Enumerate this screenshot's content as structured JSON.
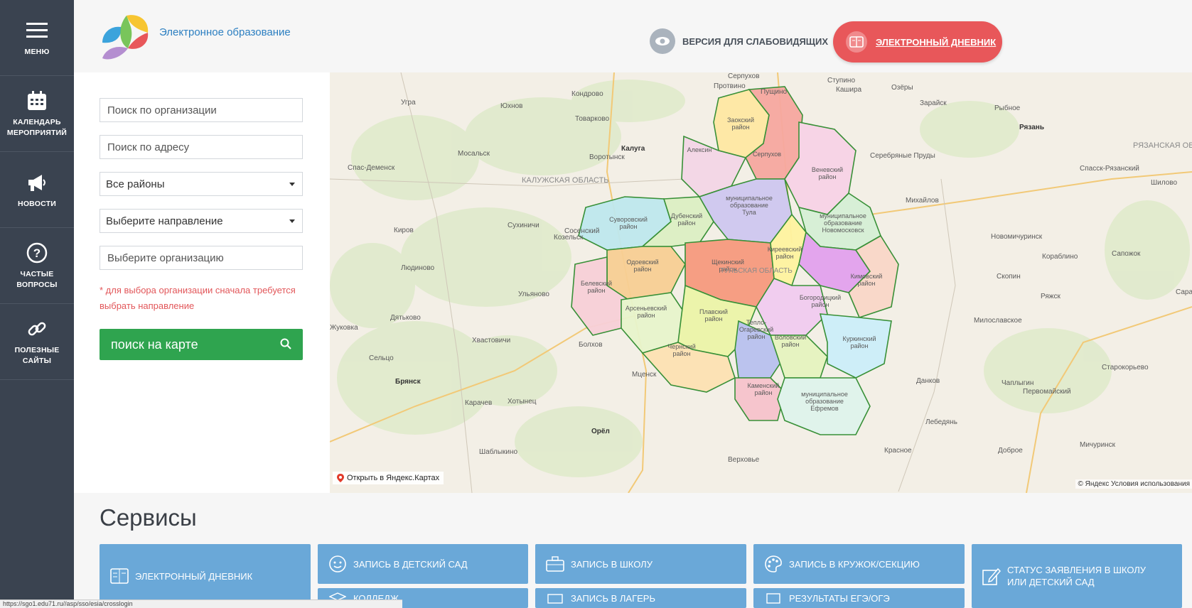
{
  "sidebar": {
    "items": [
      {
        "label": "Меню",
        "icon": "hamburger-icon"
      },
      {
        "label": "Календарь\nмероприятий",
        "icon": "calendar-icon"
      },
      {
        "label": "Новости",
        "icon": "megaphone-icon"
      },
      {
        "label": "Частые вопросы",
        "icon": "question-icon"
      },
      {
        "label": "Полезные сайты",
        "icon": "link-icon"
      }
    ]
  },
  "header": {
    "logo_text": "Электронное образование",
    "low_vision_label": "Версия для слабовидящих",
    "diary_button": "Электронный дневник"
  },
  "search": {
    "org_placeholder": "Поиск по организации",
    "address_placeholder": "Поиск по адресу",
    "district_selected": "Все районы",
    "direction_selected": "Выберите направление",
    "org_select": "Выберите организацию",
    "note": "* для выбора организации сначала требуется выбрать направление",
    "button": "поиск на карте"
  },
  "map": {
    "open_link": "Открыть в Яндекс.Картах",
    "copyright": "© Яндекс Условия использования",
    "region_label": "ТУЛЬСКАЯ ОБЛАСТЬ",
    "kaluga_region": "КАЛУЖСКАЯ ОБЛАСТЬ",
    "ryazan_region": "РЯЗАНСКАЯ ОБ",
    "cities": [
      "Серпухов",
      "Ступино",
      "Кашира",
      "Озёры",
      "Протвино",
      "Пущино",
      "Угра",
      "Кондрово",
      "Юхнов",
      "Товарково",
      "Калуга",
      "Мосальск",
      "Воротынск",
      "Спас-Деменск",
      "Сухиничи",
      "Киров",
      "Козельск",
      "Сосенский",
      "Людиново",
      "Ульяново",
      "Дятьково",
      "Хвастовичи",
      "Болхов",
      "Жуковка",
      "Сельцо",
      "Брянск",
      "Карачев",
      "Хотынец",
      "Мценск",
      "Орёл",
      "Шаблыкино",
      "Верховье",
      "Зарайск",
      "Рыбное",
      "Рязань",
      "Серебряные Пруды",
      "Михайлов",
      "Спасск-Рязанский",
      "Шилово",
      "Новомичуринск",
      "Сапожок",
      "Кораблино",
      "Скопин",
      "Ряжск",
      "Милославское",
      "Данков",
      "Лебедянь",
      "Чаплыгин",
      "Первомайский",
      "Старокорьево",
      "Мичуринск",
      "Доброе",
      "Красное",
      "Сараи"
    ],
    "districts": [
      "Заокский район",
      "Алексин",
      "Серпухов",
      "Веневский район",
      "Суворовский район",
      "Дубенский район",
      "муниципальное образование Тула",
      "муниципальное образование Новомосковск",
      "Одоевский район",
      "Щекинский район",
      "Киреевский район",
      "Кимовский район",
      "Белевский район",
      "Арсеньевский район",
      "Плавский район",
      "Богородицкий район",
      "Тепло-Огаревский район",
      "Воловский район",
      "Куркинский район",
      "Чернский район",
      "Каменский район",
      "муниципальное образование Ефремов"
    ]
  },
  "services": {
    "title": "Сервисы",
    "tiles": [
      {
        "label": "Электронный дневник",
        "icon": "diary-icon"
      },
      {
        "label": "Запись в детский сад",
        "icon": "smile-icon"
      },
      {
        "label": "Запись в школу",
        "icon": "briefcase-icon"
      },
      {
        "label": "Запись в кружок/секцию",
        "icon": "palette-icon"
      },
      {
        "label": "Статус заявления в школу или детский сад",
        "icon": "edit-icon"
      },
      {
        "label": "Колледж",
        "icon": "college-icon"
      },
      {
        "label": "Запись в лагерь",
        "icon": "camp-icon"
      },
      {
        "label": "Результаты ЕГЭ/ОГЭ",
        "icon": "results-icon"
      }
    ]
  },
  "statusbar": {
    "url": "https://sgo1.edu71.ru//asp/sso/esia/crosslogin"
  },
  "colors": {
    "sidebar": "#3a4350",
    "diary": "#e8575a",
    "search": "#2fa44f",
    "tile": "#6aa8d8"
  }
}
